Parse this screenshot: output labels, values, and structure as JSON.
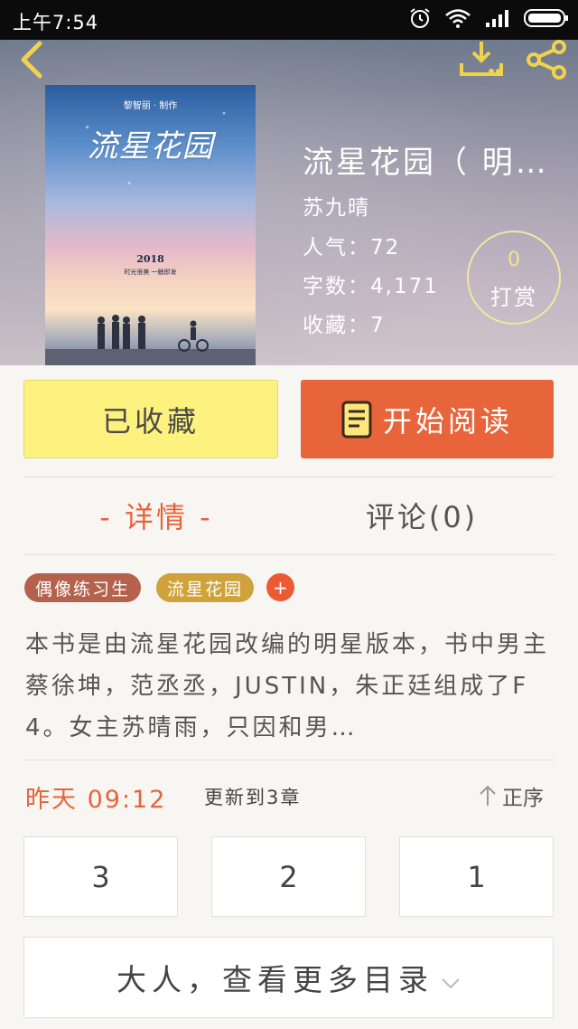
{
  "status_bar": {
    "time": "上午7:54"
  },
  "cover": {
    "subtitle": "黎智丽 · 制作",
    "title": "流星花园",
    "year": "2018",
    "tagline": "时光很美  一触即发"
  },
  "book": {
    "title": "流星花园（ 明…",
    "author": "苏九晴",
    "popularity": "人气：72",
    "word_count": "字数：4,171",
    "favorites": "收藏：7"
  },
  "tip": {
    "count": "0",
    "label": "打赏"
  },
  "actions": {
    "collected_label": "已收藏",
    "read_label": "开始阅读"
  },
  "tabs": {
    "detail": "- 详情 -",
    "comments": "评论(0)"
  },
  "tags": [
    "偶像练习生",
    "流星花园"
  ],
  "tag_add": "+",
  "description": "本书是由流星花园改编的明星版本，书中男主蔡徐坤，范丞丞，JUSTIN，朱正廷组成了F4。女主苏晴雨，只因和男…",
  "update": {
    "time": "昨天 09:12",
    "text": "更新到3章",
    "sort_label": "正序"
  },
  "chapters": [
    "3",
    "2",
    "1"
  ],
  "more_label": "大人，查看更多目录",
  "colors": {
    "accent": "#e8643a",
    "collected_bg": "#fdf27f",
    "tip_ring": "#f3e6a2"
  }
}
